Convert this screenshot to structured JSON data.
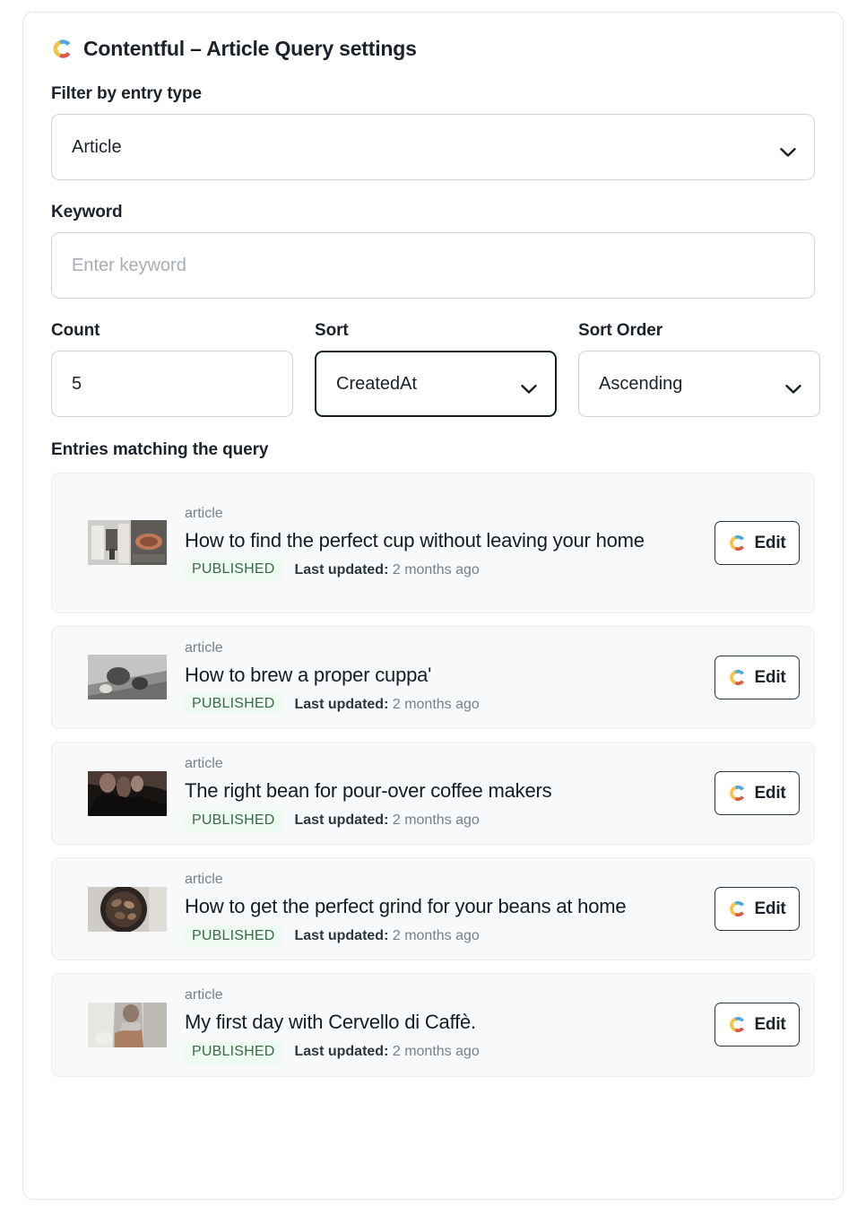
{
  "app": {
    "logo_icon": "contentful-logo-icon",
    "title": "Contentful – Article Query settings"
  },
  "brand": {
    "blue": "#4fa8e0",
    "yellow": "#f6c344",
    "red": "#d9594c",
    "text": "#1b222b",
    "card_bg": "#f7f9fa",
    "badge_bg": "#eefbf2",
    "badge_text": "#3c6a46",
    "border": "#d3d7dc"
  },
  "form": {
    "entry_type": {
      "label": "Filter by entry type",
      "value": "Article",
      "icon": "chevron-down-icon",
      "options": [
        "Article"
      ]
    },
    "keyword": {
      "label": "Keyword",
      "value": "",
      "placeholder": "Enter keyword"
    },
    "count": {
      "label": "Count",
      "value": "5",
      "placeholder": ""
    },
    "sort": {
      "label": "Sort",
      "value": "CreatedAt",
      "icon": "chevron-down-icon",
      "options": [
        "CreatedAt"
      ]
    },
    "sort_order": {
      "label": "Sort Order",
      "value": "Ascending",
      "icon": "chevron-down-icon",
      "options": [
        "Ascending"
      ]
    }
  },
  "entries_section": {
    "title": "Entries matching the query",
    "edit_label": "Edit",
    "items": [
      {
        "type": "article",
        "title": "How to find the perfect cup without leaving your home",
        "status": "PUBLISHED",
        "updated_label": "Last updated:",
        "updated_value": "2 months ago",
        "thumb": "espresso-machine-thumbnail"
      },
      {
        "type": "article",
        "title": "How to brew a proper cuppa'",
        "status": "PUBLISHED",
        "updated_label": "Last updated:",
        "updated_value": "2 months ago",
        "thumb": "tea-brewing-thumbnail"
      },
      {
        "type": "article",
        "title": "The right bean for pour-over coffee makers",
        "status": "PUBLISHED",
        "updated_label": "Last updated:",
        "updated_value": "2 months ago",
        "thumb": "dark-beans-thumbnail"
      },
      {
        "type": "article",
        "title": "How to get the perfect grind for your beans at home",
        "status": "PUBLISHED",
        "updated_label": "Last updated:",
        "updated_value": "2 months ago",
        "thumb": "coffee-grinder-thumbnail"
      },
      {
        "type": "article",
        "title": "My first day with Cervello di Caffè.",
        "status": "PUBLISHED",
        "updated_label": "Last updated:",
        "updated_value": "2 months ago",
        "thumb": "barista-thumbnail"
      }
    ]
  }
}
